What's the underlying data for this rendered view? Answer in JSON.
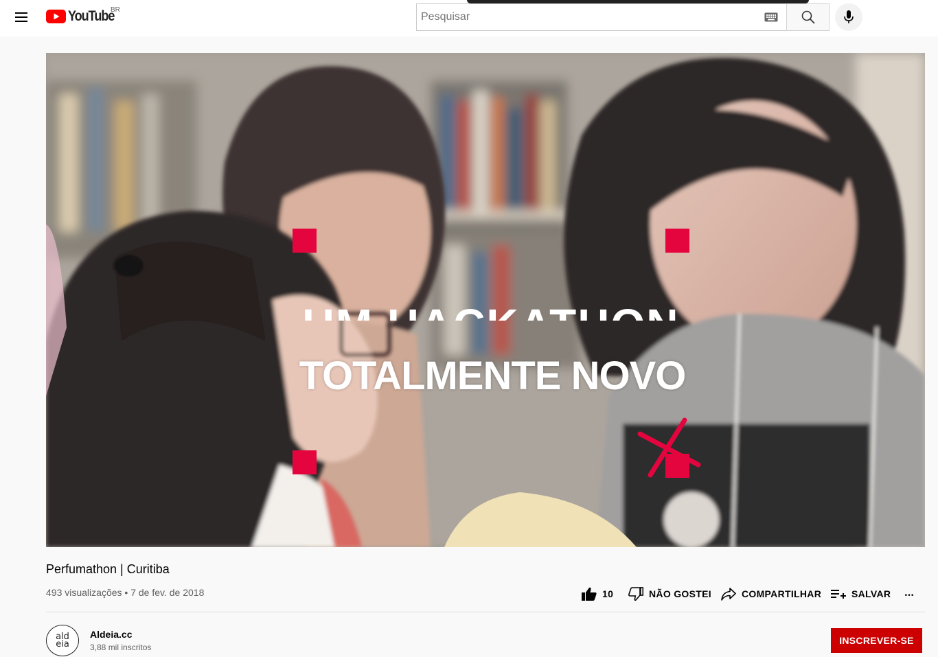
{
  "masthead": {
    "logo_text": "YouTube",
    "country_code": "BR",
    "search": {
      "placeholder": "Pesquisar",
      "value": ""
    }
  },
  "player": {
    "overlay_line1": "UM HACKATHON",
    "overlay_line2": "TOTALMENTE NOVO",
    "accent_color": "#e4053f"
  },
  "video": {
    "title": "Perfumathon | Curitiba",
    "views": "493 visualizações",
    "separator": "•",
    "date": "7 de fev. de 2018"
  },
  "actions": {
    "like_count": "10",
    "dislike_label": "NÃO GOSTEI",
    "share_label": "COMPARTILHAR",
    "save_label": "SALVAR"
  },
  "channel": {
    "name": "Aldeia.cc",
    "subscribers": "3,88 mil inscritos",
    "avatar_line1": "ald",
    "avatar_line2": "eia",
    "subscribe_label": "INSCREVER-SE"
  },
  "colors": {
    "brand_red": "#ff0000",
    "subscribe_red": "#cc0000"
  }
}
